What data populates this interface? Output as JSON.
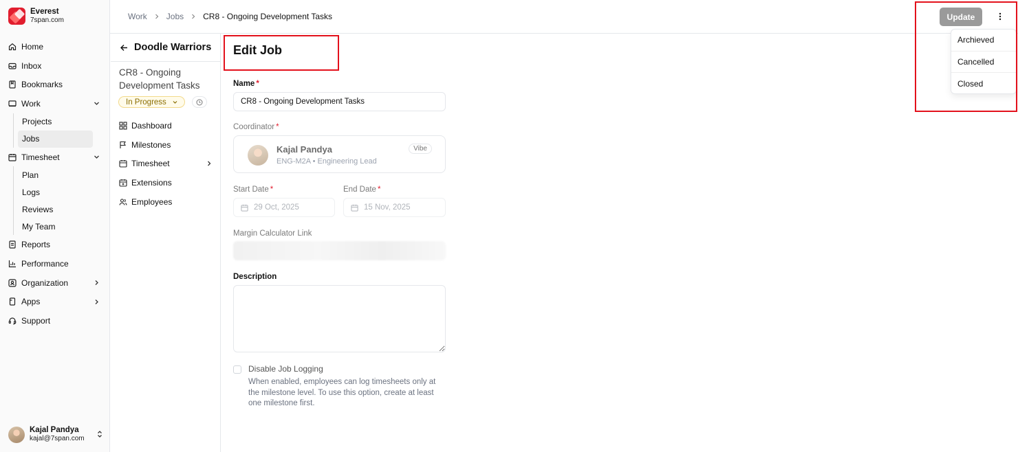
{
  "brand": {
    "name": "Everest",
    "domain": "7span.com",
    "accent": "#e11d2e"
  },
  "nav": {
    "home": "Home",
    "inbox": "Inbox",
    "bookmarks": "Bookmarks",
    "work": "Work",
    "work_items": [
      "Projects",
      "Jobs"
    ],
    "timesheet": "Timesheet",
    "timesheet_items": [
      "Plan",
      "Logs",
      "Reviews",
      "My Team"
    ],
    "reports": "Reports",
    "performance": "Performance",
    "organization": "Organization",
    "apps": "Apps",
    "support": "Support"
  },
  "user": {
    "name": "Kajal Pandya",
    "email": "kajal@7span.com"
  },
  "breadcrumb": [
    "Work",
    "Jobs",
    "CR8 - Ongoing Development Tasks"
  ],
  "header": {
    "update_label": "Update"
  },
  "menu": {
    "items": [
      "Archieved",
      "Cancelled",
      "Closed"
    ]
  },
  "panel": {
    "title": "Doodle Warriors",
    "job_title": "CR8 - Ongoing Development Tasks",
    "status": "In Progress",
    "status_color": "#8a6d00",
    "items": [
      "Dashboard",
      "Milestones",
      "Timesheet",
      "Extensions",
      "Employees"
    ]
  },
  "form": {
    "title": "Edit Job",
    "name_label": "Name",
    "name_value": "CR8 - Ongoing Development Tasks",
    "coordinator_label": "Coordinator",
    "coordinator": {
      "name": "Kajal Pandya",
      "code": "ENG-M2A",
      "role": "Engineering Lead",
      "badge": "Vibe"
    },
    "start_label": "Start Date",
    "start_value": "29 Oct, 2025",
    "end_label": "End Date",
    "end_value": "15 Nov, 2025",
    "margin_label": "Margin Calculator Link",
    "description_label": "Description",
    "description_value": "",
    "disable_logging_label": "Disable Job Logging",
    "disable_logging_help": "When enabled, employees can log timesheets only at the milestone level. To use this option, create at least one milestone first."
  }
}
